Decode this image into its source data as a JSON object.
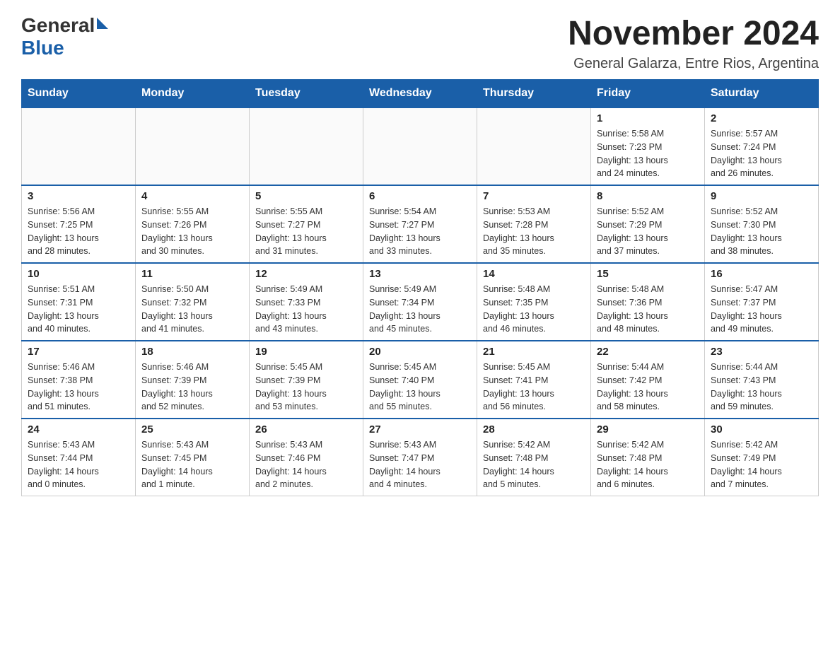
{
  "logo": {
    "text_general": "General",
    "text_blue": "Blue"
  },
  "title": "November 2024",
  "subtitle": "General Galarza, Entre Rios, Argentina",
  "days_of_week": [
    "Sunday",
    "Monday",
    "Tuesday",
    "Wednesday",
    "Thursday",
    "Friday",
    "Saturday"
  ],
  "weeks": [
    [
      {
        "day": "",
        "info": ""
      },
      {
        "day": "",
        "info": ""
      },
      {
        "day": "",
        "info": ""
      },
      {
        "day": "",
        "info": ""
      },
      {
        "day": "",
        "info": ""
      },
      {
        "day": "1",
        "info": "Sunrise: 5:58 AM\nSunset: 7:23 PM\nDaylight: 13 hours\nand 24 minutes."
      },
      {
        "day": "2",
        "info": "Sunrise: 5:57 AM\nSunset: 7:24 PM\nDaylight: 13 hours\nand 26 minutes."
      }
    ],
    [
      {
        "day": "3",
        "info": "Sunrise: 5:56 AM\nSunset: 7:25 PM\nDaylight: 13 hours\nand 28 minutes."
      },
      {
        "day": "4",
        "info": "Sunrise: 5:55 AM\nSunset: 7:26 PM\nDaylight: 13 hours\nand 30 minutes."
      },
      {
        "day": "5",
        "info": "Sunrise: 5:55 AM\nSunset: 7:27 PM\nDaylight: 13 hours\nand 31 minutes."
      },
      {
        "day": "6",
        "info": "Sunrise: 5:54 AM\nSunset: 7:27 PM\nDaylight: 13 hours\nand 33 minutes."
      },
      {
        "day": "7",
        "info": "Sunrise: 5:53 AM\nSunset: 7:28 PM\nDaylight: 13 hours\nand 35 minutes."
      },
      {
        "day": "8",
        "info": "Sunrise: 5:52 AM\nSunset: 7:29 PM\nDaylight: 13 hours\nand 37 minutes."
      },
      {
        "day": "9",
        "info": "Sunrise: 5:52 AM\nSunset: 7:30 PM\nDaylight: 13 hours\nand 38 minutes."
      }
    ],
    [
      {
        "day": "10",
        "info": "Sunrise: 5:51 AM\nSunset: 7:31 PM\nDaylight: 13 hours\nand 40 minutes."
      },
      {
        "day": "11",
        "info": "Sunrise: 5:50 AM\nSunset: 7:32 PM\nDaylight: 13 hours\nand 41 minutes."
      },
      {
        "day": "12",
        "info": "Sunrise: 5:49 AM\nSunset: 7:33 PM\nDaylight: 13 hours\nand 43 minutes."
      },
      {
        "day": "13",
        "info": "Sunrise: 5:49 AM\nSunset: 7:34 PM\nDaylight: 13 hours\nand 45 minutes."
      },
      {
        "day": "14",
        "info": "Sunrise: 5:48 AM\nSunset: 7:35 PM\nDaylight: 13 hours\nand 46 minutes."
      },
      {
        "day": "15",
        "info": "Sunrise: 5:48 AM\nSunset: 7:36 PM\nDaylight: 13 hours\nand 48 minutes."
      },
      {
        "day": "16",
        "info": "Sunrise: 5:47 AM\nSunset: 7:37 PM\nDaylight: 13 hours\nand 49 minutes."
      }
    ],
    [
      {
        "day": "17",
        "info": "Sunrise: 5:46 AM\nSunset: 7:38 PM\nDaylight: 13 hours\nand 51 minutes."
      },
      {
        "day": "18",
        "info": "Sunrise: 5:46 AM\nSunset: 7:39 PM\nDaylight: 13 hours\nand 52 minutes."
      },
      {
        "day": "19",
        "info": "Sunrise: 5:45 AM\nSunset: 7:39 PM\nDaylight: 13 hours\nand 53 minutes."
      },
      {
        "day": "20",
        "info": "Sunrise: 5:45 AM\nSunset: 7:40 PM\nDaylight: 13 hours\nand 55 minutes."
      },
      {
        "day": "21",
        "info": "Sunrise: 5:45 AM\nSunset: 7:41 PM\nDaylight: 13 hours\nand 56 minutes."
      },
      {
        "day": "22",
        "info": "Sunrise: 5:44 AM\nSunset: 7:42 PM\nDaylight: 13 hours\nand 58 minutes."
      },
      {
        "day": "23",
        "info": "Sunrise: 5:44 AM\nSunset: 7:43 PM\nDaylight: 13 hours\nand 59 minutes."
      }
    ],
    [
      {
        "day": "24",
        "info": "Sunrise: 5:43 AM\nSunset: 7:44 PM\nDaylight: 14 hours\nand 0 minutes."
      },
      {
        "day": "25",
        "info": "Sunrise: 5:43 AM\nSunset: 7:45 PM\nDaylight: 14 hours\nand 1 minute."
      },
      {
        "day": "26",
        "info": "Sunrise: 5:43 AM\nSunset: 7:46 PM\nDaylight: 14 hours\nand 2 minutes."
      },
      {
        "day": "27",
        "info": "Sunrise: 5:43 AM\nSunset: 7:47 PM\nDaylight: 14 hours\nand 4 minutes."
      },
      {
        "day": "28",
        "info": "Sunrise: 5:42 AM\nSunset: 7:48 PM\nDaylight: 14 hours\nand 5 minutes."
      },
      {
        "day": "29",
        "info": "Sunrise: 5:42 AM\nSunset: 7:48 PM\nDaylight: 14 hours\nand 6 minutes."
      },
      {
        "day": "30",
        "info": "Sunrise: 5:42 AM\nSunset: 7:49 PM\nDaylight: 14 hours\nand 7 minutes."
      }
    ]
  ]
}
